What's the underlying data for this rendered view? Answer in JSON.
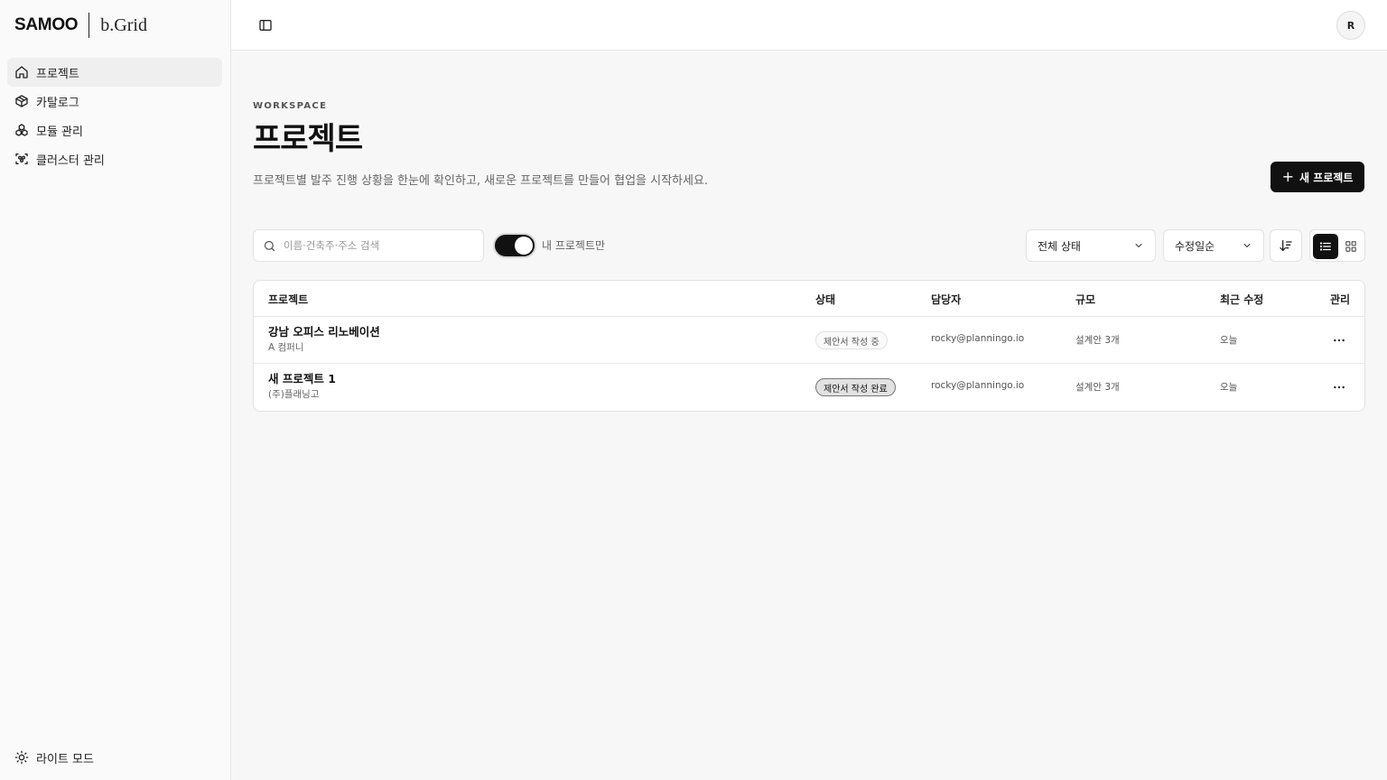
{
  "brand": {
    "name": "SAMOO",
    "product": "b.Grid"
  },
  "sidebar": {
    "items": [
      {
        "label": "프로젝트",
        "icon": "home-icon",
        "active": true
      },
      {
        "label": "카탈로그",
        "icon": "box-icon",
        "active": false
      },
      {
        "label": "모듈 관리",
        "icon": "modules-icon",
        "active": false
      },
      {
        "label": "클러스터 관리",
        "icon": "cluster-icon",
        "active": false
      }
    ],
    "theme_label": "라이트 모드"
  },
  "header": {
    "avatar_initial": "R"
  },
  "page": {
    "eyebrow": "WORKSPACE",
    "title": "프로젝트",
    "subtitle": "프로젝트별 발주 진행 상황을 한눈에 확인하고, 새로운 프로젝트를 만들어 협업을 시작하세요.",
    "new_button_label": "새 프로젝트"
  },
  "filters": {
    "search_placeholder": "이름·건축주·주소 검색",
    "my_projects_label": "내 프로젝트만",
    "my_projects_on": true,
    "status_value": "전체 상태",
    "sort_value": "수정일순",
    "view_mode": "list"
  },
  "table": {
    "headers": {
      "name": "프로젝트",
      "status": "상태",
      "owner": "담당자",
      "scale": "규모",
      "updated": "최근 수정",
      "manage": "관리"
    },
    "rows": [
      {
        "name": "강남 오피스 리노베이션",
        "client": "A 컴퍼니",
        "status": "제안서 작성 중",
        "status_style": "outline",
        "owner": "rocky@planningo.io",
        "scale": "설계안 3개",
        "updated": "오늘"
      },
      {
        "name": "새 프로젝트 1",
        "client": "(주)플래닝고",
        "status": "제안서 작성 완료",
        "status_style": "filled",
        "owner": "rocky@planningo.io",
        "scale": "설계안 3개",
        "updated": "오늘"
      }
    ]
  },
  "colors": {
    "primary": "#111111",
    "background": "#f7f7f7",
    "border": "#e2e2e2"
  }
}
